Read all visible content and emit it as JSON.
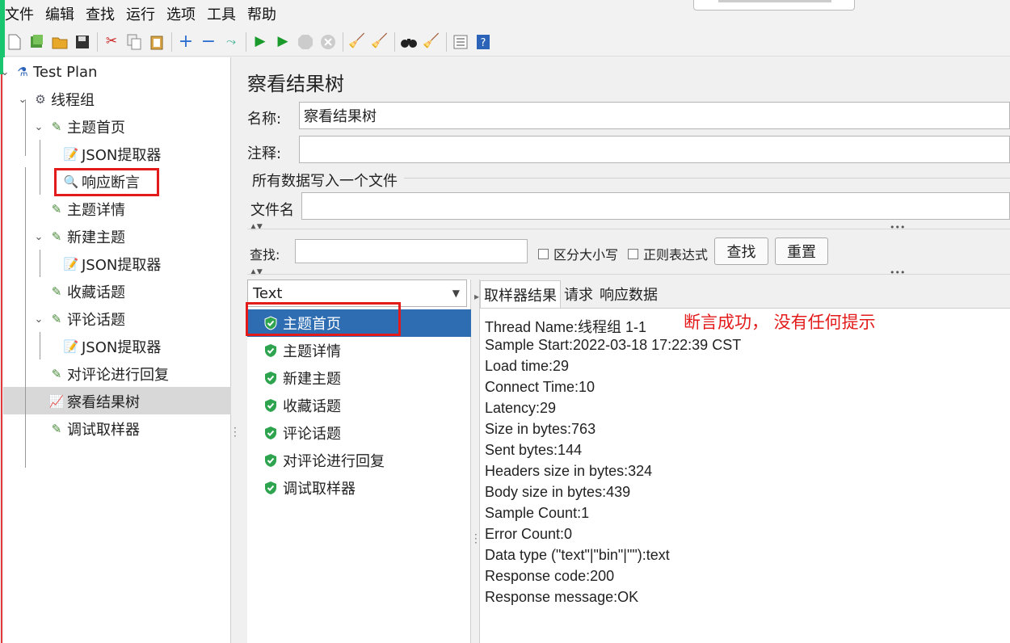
{
  "menu": [
    "文件",
    "编辑",
    "查找",
    "运行",
    "选项",
    "工具",
    "帮助"
  ],
  "tree": {
    "nodes": [
      {
        "label": "Test Plan",
        "icon": "flask-icon"
      },
      {
        "label": "线程组",
        "icon": "gear-icon"
      },
      {
        "label": "主题首页",
        "icon": "pen-icon"
      },
      {
        "label": "JSON提取器",
        "icon": "extractor-icon"
      },
      {
        "label": "响应断言",
        "icon": "magnifier-icon"
      },
      {
        "label": "主题详情",
        "icon": "pen-icon"
      },
      {
        "label": "新建主题",
        "icon": "pen-icon"
      },
      {
        "label": "JSON提取器",
        "icon": "extractor-icon"
      },
      {
        "label": "收藏话题",
        "icon": "pen-icon"
      },
      {
        "label": "评论话题",
        "icon": "pen-icon"
      },
      {
        "label": "JSON提取器",
        "icon": "extractor-icon"
      },
      {
        "label": "对评论进行回复",
        "icon": "pen-icon"
      },
      {
        "label": "察看结果树",
        "icon": "chart-icon"
      },
      {
        "label": "调试取样器",
        "icon": "pen-icon"
      }
    ]
  },
  "panel": {
    "title": "察看结果树",
    "name_label": "名称:",
    "name_value": "察看结果树",
    "comment_label": "注释:",
    "comment_value": "",
    "file_group": "所有数据写入一个文件",
    "filename_label": "文件名",
    "filename_value": "",
    "search_label": "查找:",
    "search_value": "",
    "case_sensitive": "区分大小写",
    "regex": "正则表达式",
    "find_button": "查找",
    "reset_button": "重置"
  },
  "results": {
    "renderer": "Text",
    "items": [
      "主题首页",
      "主题详情",
      "新建主题",
      "收藏话题",
      "评论话题",
      "对评论进行回复",
      "调试取样器"
    ],
    "selected": "主题首页"
  },
  "detail": {
    "tabs": [
      "取样器结果",
      "请求",
      "响应数据"
    ],
    "lines": [
      "Thread Name:线程组 1-1",
      "Sample Start:2022-03-18 17:22:39 CST",
      "Load time:29",
      "Connect Time:10",
      "Latency:29",
      "Size in bytes:763",
      "Sent bytes:144",
      "Headers size in bytes:324",
      "Body size in bytes:439",
      "Sample Count:1",
      "Error Count:0",
      "Data type (\"text\"|\"bin\"|\"\"):text",
      "Response code:200",
      "Response message:OK"
    ]
  },
  "annotation": "断言成功， 没有任何提示",
  "colors": {
    "selection": "#2f6db3",
    "annotation": "#e31b1b",
    "success": "#2ea44f"
  }
}
